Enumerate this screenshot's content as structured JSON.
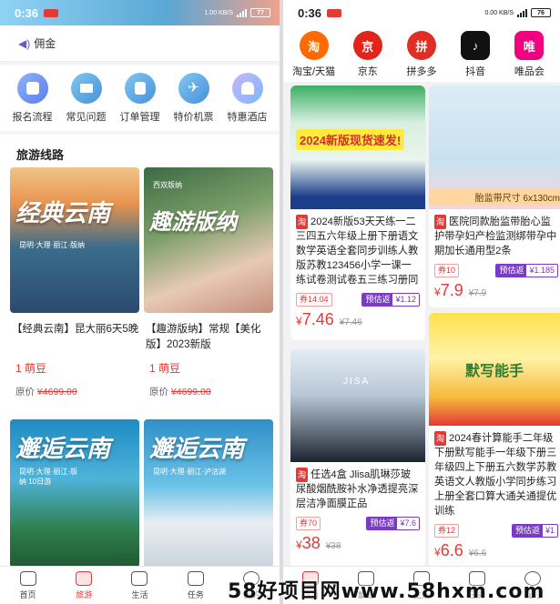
{
  "left": {
    "status": {
      "time": "0:36",
      "net": "1.00 KB/S",
      "battery": "77"
    },
    "commission_label": "佣金",
    "quick_nav": [
      {
        "label": "报名流程",
        "icon": "register-icon",
        "color": "#5b8def"
      },
      {
        "label": "常见问题",
        "icon": "faq-icon",
        "color": "#4aa3df"
      },
      {
        "label": "订单管理",
        "icon": "order-icon",
        "color": "#4aa3df"
      },
      {
        "label": "特价机票",
        "icon": "plane-icon",
        "color": "#4aa3df"
      },
      {
        "label": "特惠酒店",
        "icon": "hotel-icon",
        "color": "#4aa3df"
      }
    ],
    "section_title": "旅游线路",
    "tours": [
      {
        "img_text": "经典云南",
        "img_sub": "昆明·大理·丽江·版纳",
        "title": "【经典云南】昆大丽6天5晚",
        "points": "1 萌豆",
        "price_label": "原价",
        "price": "¥4699.00"
      },
      {
        "img_text": "趣游版纳",
        "img_sub": "西双版纳",
        "title": "【趣游版纳】常规【美化版】2023新版",
        "points": "1 萌豆",
        "price_label": "原价",
        "price": "¥4699.00"
      },
      {
        "img_text": "邂逅云南",
        "img_sub": "昆明·大理·丽江·版纳 10日游",
        "title": "",
        "points": "",
        "price_label": "",
        "price": ""
      },
      {
        "img_text": "邂逅云南",
        "img_sub": "昆明·大理·丽江·泸沽湖",
        "title": "",
        "points": "",
        "price_label": "",
        "price": ""
      }
    ],
    "nav": [
      {
        "label": "首页",
        "active": false
      },
      {
        "label": "旅游",
        "active": true
      },
      {
        "label": "生活",
        "active": false
      },
      {
        "label": "任务",
        "active": false
      },
      {
        "label": "我的",
        "active": false
      }
    ]
  },
  "right": {
    "status": {
      "time": "0:36",
      "net": "0.00 KB/S",
      "battery": "76"
    },
    "shops": [
      {
        "label": "淘宝/天猫",
        "glyph": "淘",
        "color": "#ff6a00"
      },
      {
        "label": "京东",
        "glyph": "京",
        "color": "#e1251b"
      },
      {
        "label": "拼多多",
        "glyph": "拼",
        "color": "#e02e24"
      },
      {
        "label": "抖音",
        "glyph": "♪",
        "color": "#111111"
      },
      {
        "label": "唯品会",
        "glyph": "唯",
        "color": "#f10180"
      }
    ],
    "products": [
      {
        "badge": "淘",
        "img_text": "2024新版现货速发!",
        "title": "2024新版53天天练一二三四五六年级上册下册语文数学英语全套同步训练人教版苏教123456小学一课一练试卷测试卷五三练习册同步作业",
        "coupon": "券14.04",
        "rebate_k": "预估返",
        "rebate_v": "¥1.12",
        "price": "7.46",
        "orig": "¥7.46"
      },
      {
        "badge": "淘",
        "img_text": "胎监带尺寸 6x130cm",
        "title": "医院同款胎监带胎心监护带孕妇产检监测绑带孕中期加长通用型2条",
        "coupon": "券10",
        "rebate_k": "预估返",
        "rebate_v": "¥1.185",
        "price": "7.9",
        "orig": "¥7.9"
      },
      {
        "badge": "淘",
        "img_text": "JISA",
        "title": "任选4盒 Jlisa肌琳莎玻尿酸烟酰胺补水净透提亮深层洁净面膜正品",
        "coupon": "券70",
        "rebate_k": "预估返",
        "rebate_v": "¥7.6",
        "price": "38",
        "orig": "¥38"
      },
      {
        "badge": "淘",
        "img_text": "默写能手",
        "title": "2024春计算能手二年级下册默写能手一年级下册三年级四上下册五六数学苏教英语文人教版小学同步练习上册全套口算大通关通提优训练",
        "coupon": "券12",
        "rebate_k": "预估返",
        "rebate_v": "¥1",
        "price": "6.6",
        "orig": "¥6.6"
      }
    ],
    "nav": [
      {
        "label": "首页",
        "active": true
      },
      {
        "label": "旅游",
        "active": false
      },
      {
        "label": "生活",
        "active": false
      },
      {
        "label": "任务",
        "active": false
      },
      {
        "label": "我的",
        "active": false
      }
    ]
  },
  "watermark": "58好项目网www.58hxm.com"
}
